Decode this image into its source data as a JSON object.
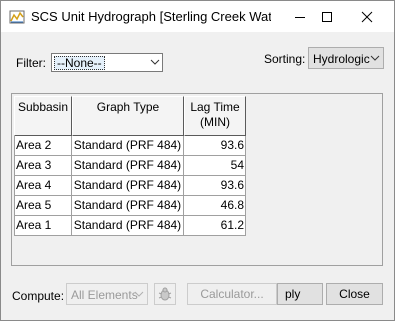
{
  "window": {
    "title": "SCS Unit Hydrograph [Sterling Creek Wat..."
  },
  "filter": {
    "label": "Filter:",
    "value": "--None--"
  },
  "sorting": {
    "label": "Sorting:",
    "value": "Hydrologic"
  },
  "table": {
    "headers": [
      "Subbasin",
      "Graph Type",
      "Lag Time",
      "(MIN)"
    ],
    "rows": [
      [
        "Area 2",
        "Standard (PRF 484)",
        "93.6"
      ],
      [
        "Area 3",
        "Standard (PRF 484)",
        "54"
      ],
      [
        "Area 4",
        "Standard (PRF 484)",
        "93.6"
      ],
      [
        "Area 5",
        "Standard (PRF 484)",
        "46.8"
      ],
      [
        "Area 1",
        "Standard (PRF 484)",
        "61.2"
      ]
    ]
  },
  "bottom": {
    "compute_label": "Compute:",
    "compute_value": "All Elements",
    "calculator_label": "Calculator...",
    "apply_label": "ply",
    "close_label": "Close"
  }
}
